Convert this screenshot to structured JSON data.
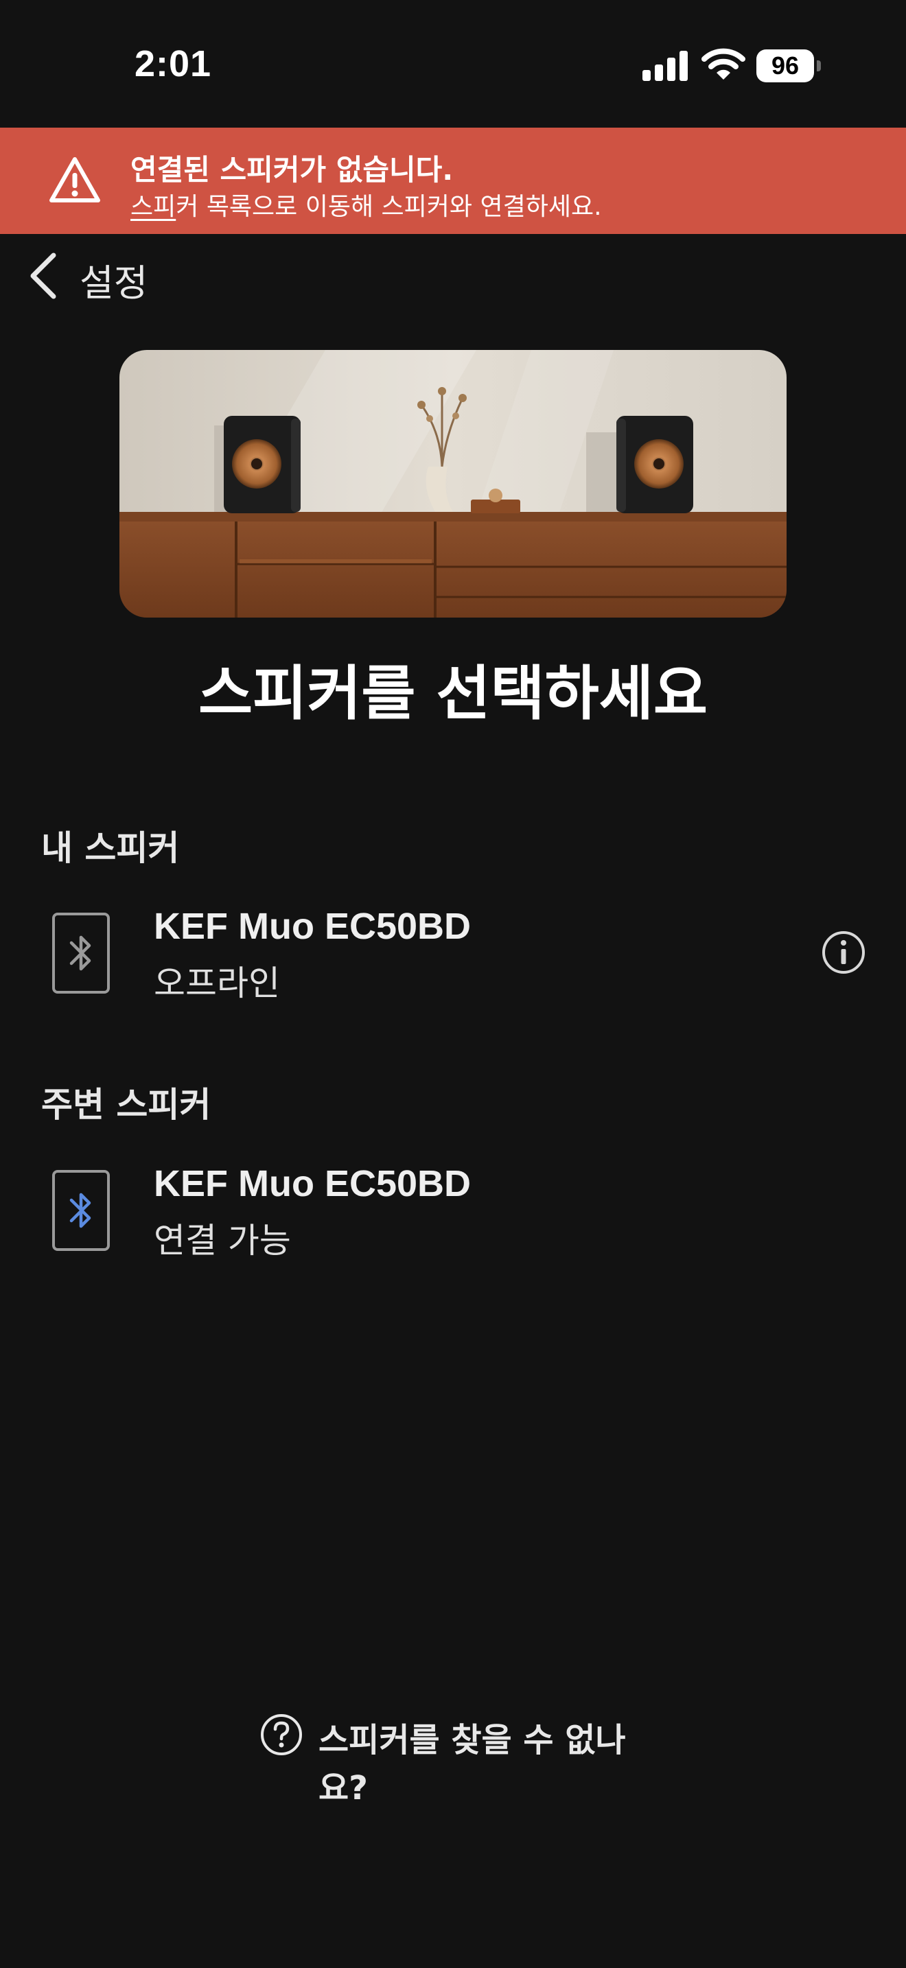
{
  "status_bar": {
    "time": "2:01",
    "battery": "96",
    "icons": [
      "signal-icon",
      "wifi-icon",
      "battery-icon"
    ]
  },
  "alert": {
    "title": "연결된 스피커가 없습니다.",
    "message_link": "스피",
    "message_rest": "커 목록으로 이동해 스피커와 연결하세요.",
    "icon": "warning-icon",
    "color": "#cf5343"
  },
  "nav": {
    "back_label": "설정",
    "icon": "chevron-left-icon"
  },
  "hero": {
    "icon": "speakers-photo"
  },
  "page": {
    "title": "스피커를 선택하세요"
  },
  "my_speakers": {
    "header": "내 스피커",
    "items": [
      {
        "name": "KEF Muo EC50BD",
        "status": "오프라인",
        "icon": "bluetooth-icon",
        "icon_color": "#9a9a9a"
      }
    ]
  },
  "nearby_speakers": {
    "header": "주변 스피커",
    "items": [
      {
        "name": "KEF Muo EC50BD",
        "status": "연결 가능",
        "icon": "bluetooth-icon",
        "icon_color": "#5b8be0"
      }
    ]
  },
  "help": {
    "label": "스피커를 찾을 수 없나요?",
    "icon": "question-circle-icon"
  },
  "colors": {
    "background": "#121212",
    "accent_blue": "#5b8be0"
  }
}
